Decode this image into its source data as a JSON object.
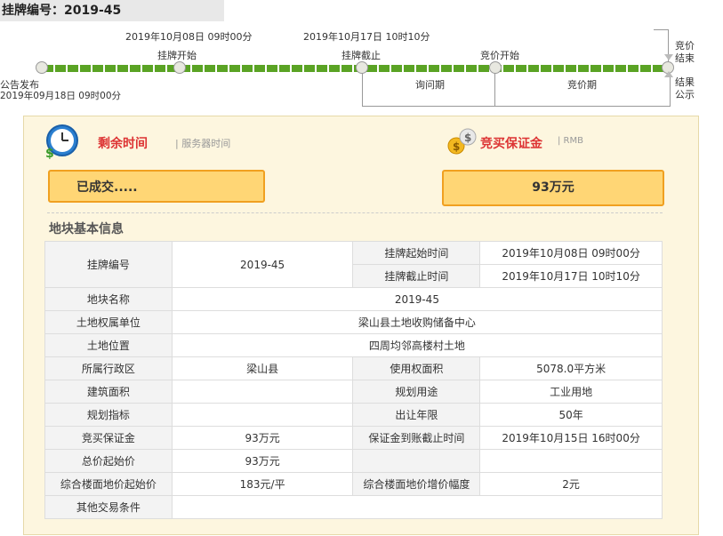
{
  "page_title": "挂牌编号：2019-45",
  "timeline": {
    "publish_label": "公告发布",
    "publish_time": "2019年09月18日 09时00分",
    "start_label": "挂牌开始",
    "start_time": "2019年10月08日 09时00分",
    "end_label": "挂牌截止",
    "end_time": "2019年10月17日 10时10分",
    "bid_start_label": "竞价开始",
    "inquiry_label": "询问期",
    "bidding_label": "竞价期",
    "bid_end_label_1": "竞价",
    "bid_end_label_2": "结束",
    "result_label_1": "结果",
    "result_label_2": "公示"
  },
  "timer": {
    "title": "剩余时间",
    "subtitle": "| 服务器时间",
    "value": "已成交....."
  },
  "deposit": {
    "title": "竞买保证金",
    "subtitle": "| RMB",
    "value": "93万元"
  },
  "section_title": "地块基本信息",
  "table": {
    "r1_label": "挂牌编号",
    "r1_value": "2019-45",
    "start_time_label": "挂牌起始时间",
    "start_time_value": "2019年10月08日 09时00分",
    "end_time_label": "挂牌截止时间",
    "end_time_value": "2019年10月17日 10时10分",
    "name_label": "地块名称",
    "name_value": "2019-45",
    "owner_label": "土地权属单位",
    "owner_value": "梁山县土地收购储备中心",
    "location_label": "土地位置",
    "location_value": "四周均邻高楼村土地",
    "district_label": "所属行政区",
    "district_value": "梁山县",
    "area_label": "使用权面积",
    "area_value": "5078.0平方米",
    "build_area_label": "建筑面积",
    "build_area_value": "",
    "usage_label": "规划用途",
    "usage_value": "工业用地",
    "plan_label": "规划指标",
    "plan_value": "",
    "term_label": "出让年限",
    "term_value": "50年",
    "deposit_label": "竞买保证金",
    "deposit_value": "93万元",
    "deposit_deadline_label": "保证金到账截止时间",
    "deposit_deadline_value": "2019年10月15日 16时00分",
    "start_price_label": "总价起始价",
    "start_price_value": "93万元",
    "floor_price_label": "综合楼面地价起始价",
    "floor_price_value": "183元/平",
    "increment_label": "综合楼面地价增价幅度",
    "increment_value": "2元",
    "other_label": "其他交易条件",
    "other_value": ""
  }
}
